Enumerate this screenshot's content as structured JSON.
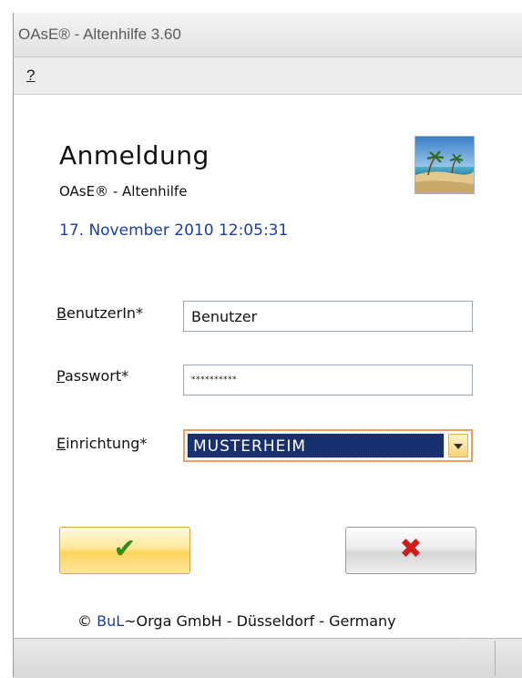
{
  "window": {
    "title": "OAsE® - Altenhilfe  3.60"
  },
  "menu": {
    "items": [
      {
        "label": "?"
      }
    ]
  },
  "login": {
    "heading": "Anmeldung",
    "subheading": "OAsE® - Altenhilfe",
    "datetime": "17. November 2010  12:05:31",
    "logo_icon": "beach-image-icon",
    "user": {
      "label_mnemonic": "B",
      "label_rest": "enutzerIn*",
      "value": "Benutzer"
    },
    "password": {
      "label_mnemonic": "P",
      "label_rest": "asswort*",
      "value": "**********"
    },
    "facility": {
      "label_mnemonic": "E",
      "label_rest": "inrichtung*",
      "value": "MUSTERHEIM"
    },
    "ok_button": {
      "icon": "checkmark-icon",
      "glyph": "✔"
    },
    "cancel_button": {
      "icon": "close-icon",
      "glyph": "✖"
    },
    "copyright": {
      "symbol": "©",
      "brand": "BuL",
      "rest": "~Orga GmbH - Düsseldorf - Germany"
    }
  },
  "colors": {
    "link_blue": "#1a3ea8",
    "selection_bg": "#18306e",
    "ok_gold": "#ffd45b",
    "check_green": "#2f8f1a",
    "cancel_red": "#d21c1c"
  }
}
